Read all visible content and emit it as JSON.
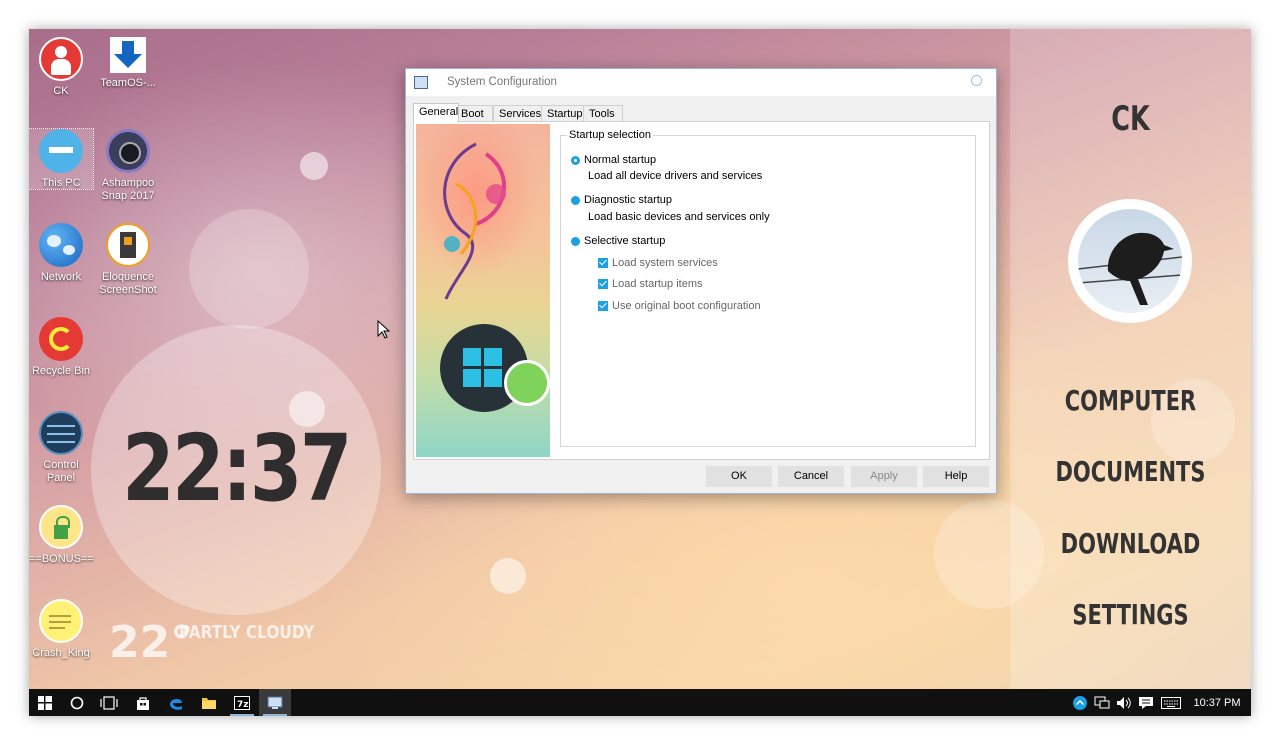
{
  "desktop": {
    "icons": [
      {
        "label": "CK"
      },
      {
        "label": "TeamOS-..."
      },
      {
        "label": "This PC"
      },
      {
        "label": "Ashampoo Snap 2017"
      },
      {
        "label": "Network"
      },
      {
        "label": "Eloquence ScreenShot"
      },
      {
        "label": "Recycle Bin"
      },
      {
        "label": "Control Panel"
      },
      {
        "label": "==BONUS=="
      },
      {
        "label": "Crash_King"
      }
    ]
  },
  "widget": {
    "time": "22:37",
    "temperature": "22°",
    "condition": "PARTLY CLOUDY"
  },
  "side_panel": {
    "user": "CK",
    "links": [
      "COMPUTER",
      "DOCUMENTS",
      "DOWNLOAD",
      "SETTINGS"
    ]
  },
  "dialog": {
    "title": "System Configuration",
    "tabs": [
      "General",
      "Boot",
      "Services",
      "Startup",
      "Tools"
    ],
    "active_tab": "General",
    "group_label": "Startup selection",
    "options": [
      {
        "label": "Normal startup",
        "description": "Load all device drivers and services",
        "selected": true
      },
      {
        "label": "Diagnostic startup",
        "description": "Load basic devices and services only",
        "selected": false
      },
      {
        "label": "Selective startup",
        "description": "",
        "selected": false
      }
    ],
    "checkboxes": [
      {
        "label": "Load system services",
        "checked": true
      },
      {
        "label": "Load startup items",
        "checked": true
      },
      {
        "label": "Use original boot configuration",
        "checked": true
      }
    ],
    "buttons": {
      "ok": "OK",
      "cancel": "Cancel",
      "apply": "Apply",
      "help": "Help"
    }
  },
  "taskbar": {
    "pinned": [
      "start-icon",
      "cortana-icon",
      "task-view-icon",
      "store-icon",
      "edge-icon",
      "file-explorer-icon",
      "7zip-icon",
      "system-config-icon"
    ],
    "clock": "10:37 PM",
    "tray": [
      "show-hidden-icon",
      "network-icon",
      "volume-icon",
      "action-center-icon",
      "keyboard-icon"
    ]
  },
  "colors": {
    "accent": "#1e9fe3",
    "taskbar": "#101010",
    "clock_text": "#2f2d2e"
  }
}
